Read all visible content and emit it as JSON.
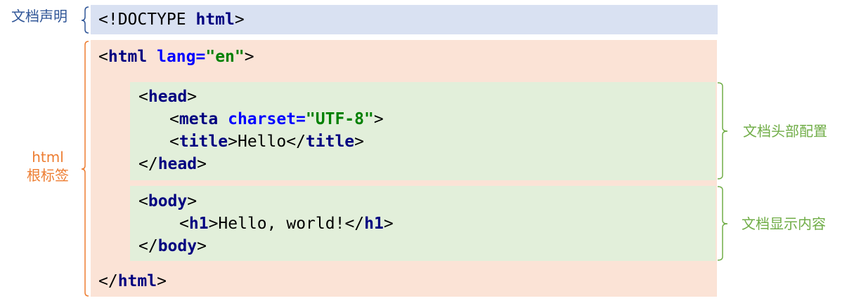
{
  "code": {
    "doctype": {
      "prefix": "<!DOCTYPE ",
      "keyword": "html",
      "suffix": ">"
    },
    "html_open": {
      "lt": "<",
      "tag": "html",
      "attr": "lang",
      "eq": "=",
      "value": "\"en\"",
      "gt": ">"
    },
    "head_open": {
      "lt": "<",
      "tag": "head",
      "gt": ">"
    },
    "meta": {
      "lt": "<",
      "tag": "meta",
      "attr": "charset",
      "eq": "=",
      "value": "\"UTF-8\"",
      "gt": ">"
    },
    "title": {
      "lt": "<",
      "tag": "title",
      "gt": ">",
      "text": "Hello",
      "close_lt": "</",
      "close_tag": "title",
      "close_gt": ">"
    },
    "head_close": {
      "lt": "</",
      "tag": "head",
      "gt": ">"
    },
    "body_open": {
      "lt": "<",
      "tag": "body",
      "gt": ">"
    },
    "h1": {
      "lt": "<",
      "tag": "h1",
      "gt": ">",
      "text": "Hello, world!",
      "close_lt": "</",
      "close_tag": "h1",
      "close_gt": ">"
    },
    "body_close": {
      "lt": "</",
      "tag": "body",
      "gt": ">"
    },
    "html_close": {
      "lt": "</",
      "tag": "html",
      "gt": ">"
    }
  },
  "labels": {
    "doctype": "文档声明",
    "html_root_line1": "html",
    "html_root_line2": "根标签",
    "head": "文档头部配置",
    "body": "文档显示内容"
  },
  "colors": {
    "doctype_bg": "#d9e1f2",
    "html_bg": "#fbe3d6",
    "head_body_bg": "#e2efda",
    "label_blue": "#2f5597",
    "label_orange": "#ed7d31",
    "label_green": "#70ad47",
    "tag_color": "#000080",
    "attr_color": "#0000ff",
    "value_color": "#008000"
  }
}
